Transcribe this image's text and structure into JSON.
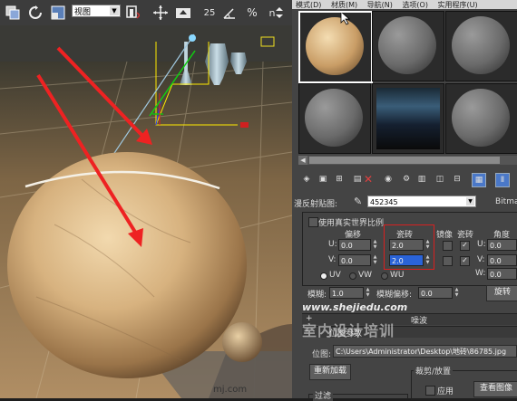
{
  "toolbar": {
    "view_dropdown": "视图",
    "snap_value": "25",
    "percent_label": "%",
    "nonparam_label": "n"
  },
  "viewport": {
    "floor_text": "mj.com"
  },
  "menubar": {
    "items": [
      "模式(D)",
      "材质(M)",
      "导航(N)",
      "选项(O)",
      "实用程序(U)"
    ]
  },
  "material_editor": {
    "map_label": "漫反射贴图:",
    "map_name": "452345",
    "map_type": "Bitma",
    "use_real_world_scale": "使用真实世界比例",
    "offset_header": "偏移",
    "tiling_header": "瓷砖",
    "mirror_header": "镜像",
    "tile_header": "瓷砖",
    "angle_header": "角度",
    "u_label": "U:",
    "v_label": "V:",
    "w_label": "W:",
    "u_offset": "0.0",
    "v_offset": "0.0",
    "u_tiling": "2.0",
    "v_tiling": "2.0",
    "u_angle": "0.0",
    "v_angle": "0.0",
    "w_angle": "0.0",
    "uv_option": "UV",
    "vw_option": "VW",
    "wu_option": "WU",
    "blur_label": "模糊:",
    "blur_value": "1.0",
    "blur_offset_label": "模糊偏移:",
    "blur_offset_value": "0.0",
    "rotate_button": "旋转",
    "rollout_noise": "噪波",
    "rollout_params": "位图参数",
    "bitmap_path_label": "位图:",
    "bitmap_path": "C:\\Users\\Administrator\\Desktop\\地砖\\86785.jpg",
    "reload_button": "重新加载",
    "crop_group": "裁剪/放置",
    "apply_label": "应用",
    "view_image_button": "查看图像",
    "filter_group": "过滤"
  },
  "watermark": {
    "url": "www.shejiedu.com",
    "name": "室内设计培训"
  },
  "colors": {
    "arrow_red": "#ee2222",
    "highlight_box": "#d82020",
    "selected_field": "#2a63d8"
  }
}
